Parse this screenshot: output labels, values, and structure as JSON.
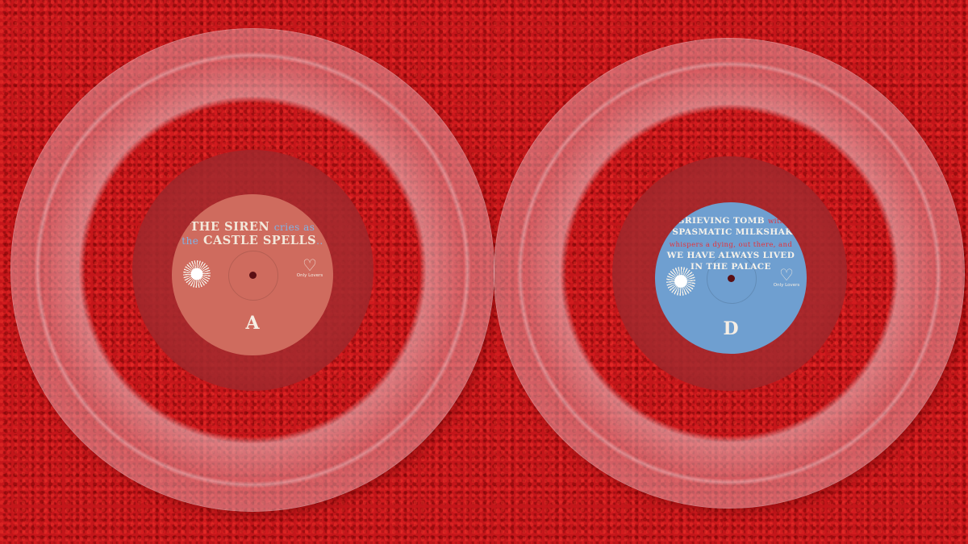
{
  "records": [
    {
      "label_color": "#cf6b5e",
      "title_line1_main": "THE SIREN",
      "title_line1_accent": "cries as",
      "title_line2_accent": "the",
      "title_line2_main": "CASTLE SPELLS",
      "side": "A",
      "logo_text": "Only Lovers"
    },
    {
      "label_color": "#6f9fd0",
      "line1_main": "GRIEVING TOMB",
      "line1_accent": "with",
      "line2_main": "A SPASMATIC MILKSHAKE",
      "line3_accent": "whispers a dying, out there, and",
      "line4_main": "WE HAVE ALWAYS LIVED",
      "line5_main": "IN THE PALACE",
      "side": "D",
      "logo_text": "Only Lovers"
    }
  ],
  "icons": {
    "sun_emblem": "sunburst-icon",
    "heart_logo": "heart-logo-icon"
  }
}
